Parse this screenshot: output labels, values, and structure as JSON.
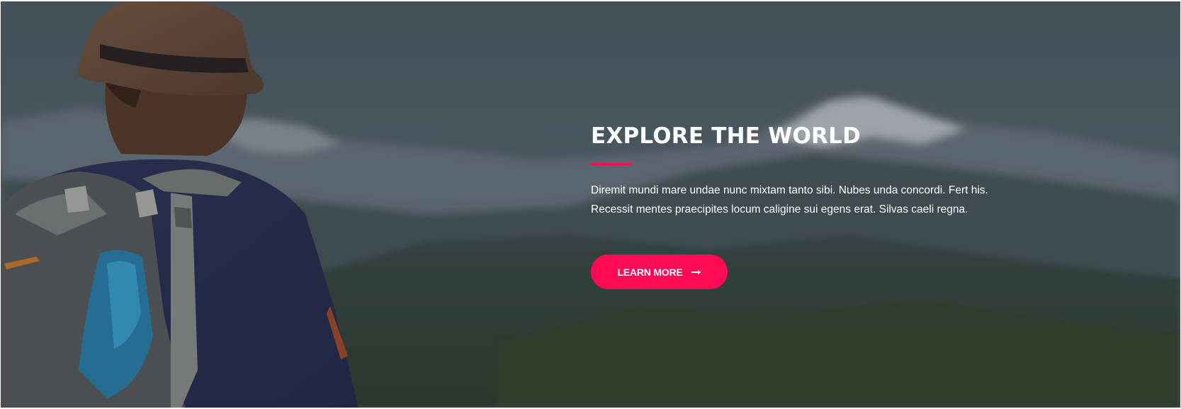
{
  "hero": {
    "title": "EXPLORE THE WORLD",
    "description_line_1": "Diremit mundi mare undae nunc mixtam tanto sibi. Nubes unda concordi. Fert his.",
    "description_line_2": "Recessit mentes praecipites locum caligine sui egens erat. Silvas caeli regna.",
    "cta_label": "LEARN MORE",
    "cta_icon": "arrow-right-icon",
    "accent_color": "#ff0a54",
    "text_color": "#ffffff"
  }
}
